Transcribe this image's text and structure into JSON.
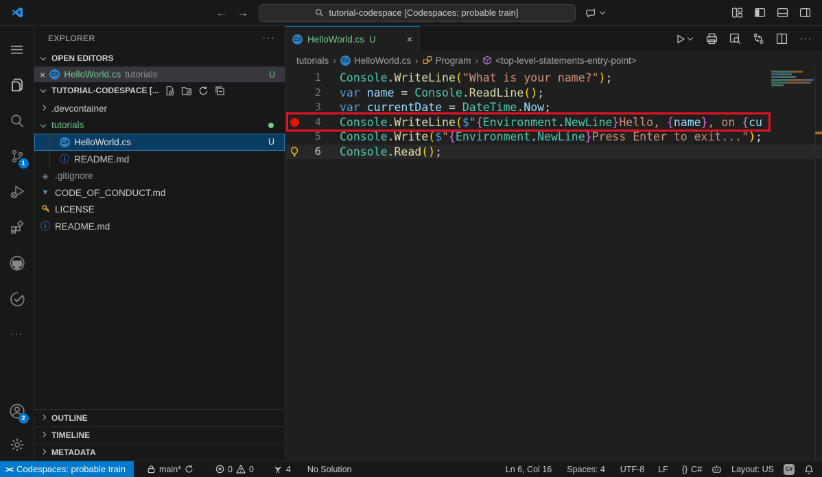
{
  "window": {
    "search": "tutorial-codespace [Codespaces: probable train]",
    "back_arrow": "←",
    "forward_arrow": "→"
  },
  "activity_bar": {
    "source_control_badge": "1",
    "accounts_badge": "2"
  },
  "explorer": {
    "title": "EXPLORER",
    "open_editors_header": "OPEN EDITORS",
    "workspace_header": "TUTORIAL-CODESPACE [...",
    "open_editor": {
      "name": "HelloWorld.cs",
      "folder": "tutorials",
      "badge": "U"
    },
    "tree": [
      {
        "name": ".devcontainer"
      },
      {
        "name": "tutorials"
      },
      {
        "name": "HelloWorld.cs",
        "badge": "U"
      },
      {
        "name": "README.md"
      },
      {
        "name": ".gitignore"
      },
      {
        "name": "CODE_OF_CONDUCT.md"
      },
      {
        "name": "LICENSE"
      },
      {
        "name": "README.md"
      }
    ],
    "outline_header": "OUTLINE",
    "timeline_header": "TIMELINE",
    "metadata_header": "METADATA"
  },
  "editor": {
    "tab": {
      "name": "HelloWorld.cs",
      "badge": "U",
      "close": "×"
    },
    "breadcrumbs": {
      "b0": "tutorials",
      "b1": "HelloWorld.cs",
      "b2": "Program",
      "b3": "<top-level-statements-entry-point>"
    },
    "annotations": {
      "breakpoint_line": 4,
      "lightbulb_line": 6,
      "current_line": 6,
      "boxed_line": 4
    },
    "token_colors": {
      "cls": "#4EC9B0",
      "fn": "#DCDCAA",
      "kw": "#569CD6",
      "str": "#CE9178",
      "vr": "#9CDCFE",
      "pu": "#D4D4D4",
      "b1": "#FFD700",
      "b2": "#DA70D6"
    },
    "code_lines": [
      [
        [
          "cls",
          "Console"
        ],
        [
          "pu",
          "."
        ],
        [
          "fn",
          "WriteLine"
        ],
        [
          "b1",
          "("
        ],
        [
          "str",
          "\"What is your name?\""
        ],
        [
          "b1",
          ")"
        ],
        [
          "pu",
          ";"
        ]
      ],
      [
        [
          "kw",
          "var "
        ],
        [
          "vr",
          "name "
        ],
        [
          "pu",
          "= "
        ],
        [
          "cls",
          "Console"
        ],
        [
          "pu",
          "."
        ],
        [
          "fn",
          "ReadLine"
        ],
        [
          "b1",
          "()"
        ],
        [
          "pu",
          ";"
        ]
      ],
      [
        [
          "kw",
          "var "
        ],
        [
          "vr",
          "currentDate "
        ],
        [
          "pu",
          "= "
        ],
        [
          "cls",
          "DateTime"
        ],
        [
          "pu",
          "."
        ],
        [
          "vr",
          "Now"
        ],
        [
          "pu",
          ";"
        ]
      ],
      [
        [
          "cls",
          "Console"
        ],
        [
          "pu",
          "."
        ],
        [
          "fn",
          "WriteLine"
        ],
        [
          "b1",
          "("
        ],
        [
          "kw",
          "$"
        ],
        [
          "str",
          "\""
        ],
        [
          "b2",
          "{"
        ],
        [
          "cls",
          "Environment"
        ],
        [
          "pu",
          "."
        ],
        [
          "cls",
          "NewLine"
        ],
        [
          "b2",
          "}"
        ],
        [
          "str",
          "Hello, "
        ],
        [
          "b2",
          "{"
        ],
        [
          "vr",
          "name"
        ],
        [
          "b2",
          "}"
        ],
        [
          "str",
          ", on "
        ],
        [
          "b2",
          "{"
        ],
        [
          "vr",
          "cu"
        ]
      ],
      [
        [
          "cls",
          "Console"
        ],
        [
          "pu",
          "."
        ],
        [
          "fn",
          "Write"
        ],
        [
          "b1",
          "("
        ],
        [
          "kw",
          "$"
        ],
        [
          "str",
          "\""
        ],
        [
          "b2",
          "{"
        ],
        [
          "cls",
          "Environment"
        ],
        [
          "pu",
          "."
        ],
        [
          "cls",
          "NewLine"
        ],
        [
          "b2",
          "}"
        ],
        [
          "str",
          "Press Enter to exit...\""
        ],
        [
          "b1",
          ")"
        ],
        [
          "pu",
          ";"
        ]
      ],
      [
        [
          "cls",
          "Console"
        ],
        [
          "pu",
          "."
        ],
        [
          "fn",
          "Read"
        ],
        [
          "b1",
          "()"
        ],
        [
          "pu",
          ";"
        ]
      ]
    ]
  },
  "status_bar": {
    "remote": "Codespaces: probable train",
    "branch": "main*",
    "errors": "0",
    "warnings": "0",
    "ports": "4",
    "solution": "No Solution",
    "cursor": "Ln 6, Col 16",
    "indent": "Spaces: 4",
    "encoding": "UTF-8",
    "eol": "LF",
    "braces": "{}",
    "language": "C#",
    "layout": "Layout: US",
    "csharp_badge": "C#"
  },
  "colors": {
    "accent": "#0078D4",
    "remote_bg": "#007ACC",
    "untracked_green": "#73C991",
    "annotation_red": "#E81123",
    "selection_bg": "#0A3D62"
  }
}
